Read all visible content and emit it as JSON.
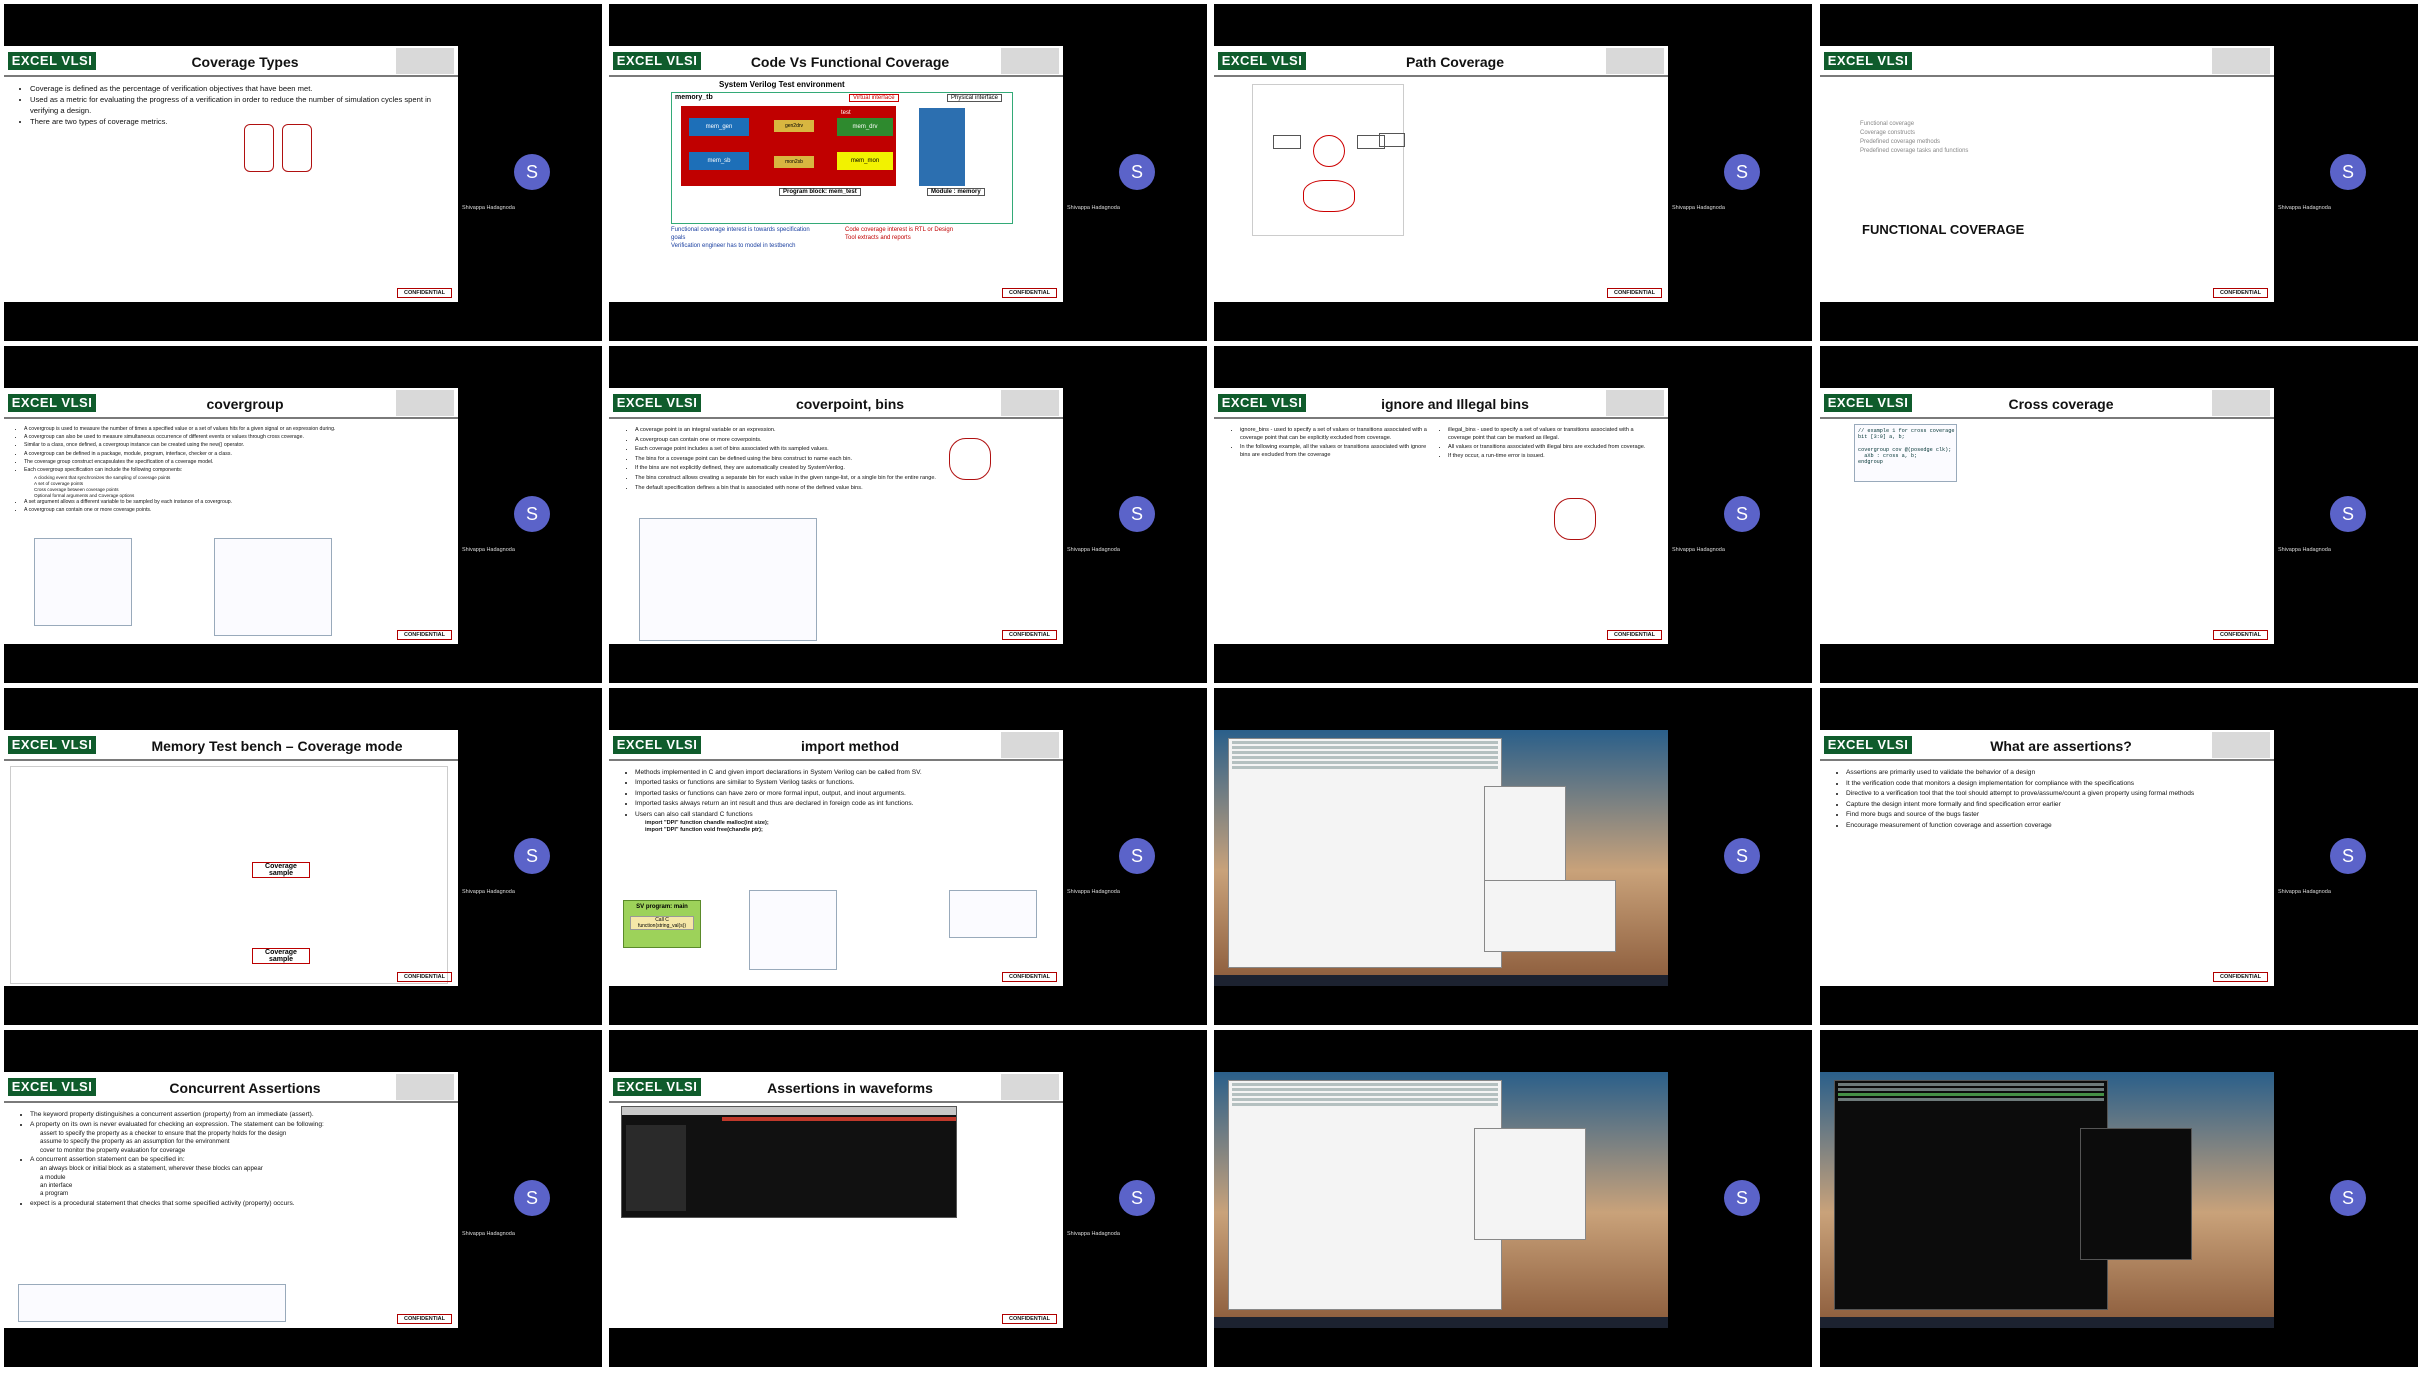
{
  "presenter_name": "Shivappa Hadagnoda",
  "avatar_letter": "S",
  "confidential": "CONFIDENTIAL",
  "logo_text": "EXCEL VLSI",
  "tiles": [
    {
      "title": "Coverage Types",
      "bullets": [
        "Coverage is defined as the percentage of verification objectives that have been met.",
        "Used as a metric for evaluating the progress of a verification in order to reduce the number of simulation cycles spent in verifying a design.",
        "There are two types of coverage metrics."
      ]
    },
    {
      "title": "Code Vs Functional Coverage",
      "env_title": "System Verilog Test environment",
      "labels": [
        "memory_tb",
        "Virtual interface",
        "Physical interface",
        "mem_gen",
        "gen2drv",
        "test",
        "mem_drv",
        "mem_sb",
        "mon2sb",
        "mem_mon",
        "Program block: mem_test",
        "Module : memory"
      ],
      "notes_left": [
        "Functional coverage interest is towards specification goals",
        "Verification engineer has to model in testbench"
      ],
      "notes_right": [
        "Code coverage interest is RTL or Design",
        "Tool extracts and reports"
      ]
    },
    {
      "title": "Path Coverage"
    },
    {
      "title": "",
      "toc": [
        "Functional coverage",
        "Coverage constructs",
        "Predefined coverage methods",
        "Predefined coverage tasks and functions"
      ],
      "big": "FUNCTIONAL COVERAGE"
    },
    {
      "title": "covergroup",
      "bullets": [
        "A covergroup is used to measure the number of times a specified value or a set of values hits for a given signal or an expression during.",
        "A covergroup can also be used to measure simultaneous occurrence of different events or values through cross coverage.",
        "Similar to a class, once defined, a covergroup instance can be created using the new() operator.",
        "A covergroup can be defined in a package, module, program, interface, checker or a class.",
        "The coverage group construct encapsulates the specification of a coverage model.",
        "Each covergroup specification can include the following components:",
        "A set argument allows a different variable to be sampled by each instance of a covergroup.",
        "A covergroup can contain one or more coverage points."
      ],
      "subs": [
        "A clocking event that synchronizes the sampling of coverage points",
        "A set of coverage points",
        "Cross coverage between coverage points",
        "Optional formal arguments and Coverage options"
      ]
    },
    {
      "title": "coverpoint, bins",
      "bullets": [
        "A coverage point is an integral variable or an expression.",
        "A covergroup can contain one or more coverpoints.",
        "Each coverage point includes a set of bins associated with its sampled values.",
        "The bins for a coverage point can be defined using the bins construct to name each bin.",
        "If the bins are not explicitly defined, they are automatically created by SystemVerilog.",
        "The bins construct allows creating a separate bin for each value in the given range-list, or a single bin for the entire range.",
        "The default specification defines a bin that is associated with none of the defined value bins."
      ]
    },
    {
      "title": "ignore and Illegal bins",
      "left": [
        "ignore_bins - used to specify a set of values or transitions associated with a coverage point that can be explicitly excluded from coverage.",
        "In the following example, all the values or transitions associated with ignore bins are excluded from the coverage"
      ],
      "right": [
        "illegal_bins - used to specify a set of values or transitions associated with a coverage point that can be marked as illegal.",
        "All values or transitions associated with illegal bins are excluded from coverage.",
        "If they occur, a run-time error is issued."
      ]
    },
    {
      "title": "Cross coverage",
      "code": "// example 1 for cross coverage\nbit [3:0] a, b;\n\ncovergroup cov @(posedge clk);\n  aXb : cross a, b;\nendgroup"
    },
    {
      "title": "Memory Test bench – Coverage mode",
      "callouts": [
        "Coverage sample",
        "Coverage sample"
      ]
    },
    {
      "title": "import method",
      "bullets": [
        "Methods implemented in C and given import declarations in System Verilog can be called from SV.",
        "Imported tasks or functions are similar to System Verilog tasks or functions.",
        "Imported tasks or functions can have zero or more formal input, output, and inout arguments.",
        "Imported tasks always return an int result and thus are declared in foreign code as int functions.",
        "Users can also call standard C functions"
      ],
      "imports": [
        "import \"DPI\" function chandle malloc(int size);",
        "import \"DPI\" function void free(chandle ptr);"
      ],
      "box1": "SV program: main",
      "box2": "Call C function(string_val(s))"
    },
    {
      "title": ""
    },
    {
      "title": "What are assertions?",
      "bullets": [
        "Assertions are primarily used to validate the behavior of a design",
        "It the verification code that monitors a design implementation for compliance with the specifications",
        "Directive to a verification tool that the tool should attempt to prove/assume/count a given property using formal methods",
        "Capture the design intent more formally and find specification error earlier",
        "Find more bugs and source of the bugs faster",
        "Encourage measurement of function coverage and assertion coverage"
      ]
    },
    {
      "title": "Concurrent Assertions",
      "bullets": [
        "The keyword property distinguishes a concurrent assertion (property) from an immediate (assert).",
        "A property on its own is never evaluated for checking an expression. The statement can be following:",
        "A concurrent assertion statement can be specified in:",
        "expect is a procedural statement that checks that some specified activity (property) occurs."
      ],
      "subs1": [
        "assert to specify the property as a checker to ensure that the property holds for the design",
        "assume to specify the property as an assumption for the environment",
        "cover to monitor the property evaluation for coverage"
      ],
      "subs2": [
        "an always block or initial block as a statement, wherever these blocks can appear",
        "a module",
        "an interface",
        "a program"
      ]
    },
    {
      "title": "Assertions in waveforms"
    },
    {
      "title": ""
    },
    {
      "title": ""
    }
  ]
}
